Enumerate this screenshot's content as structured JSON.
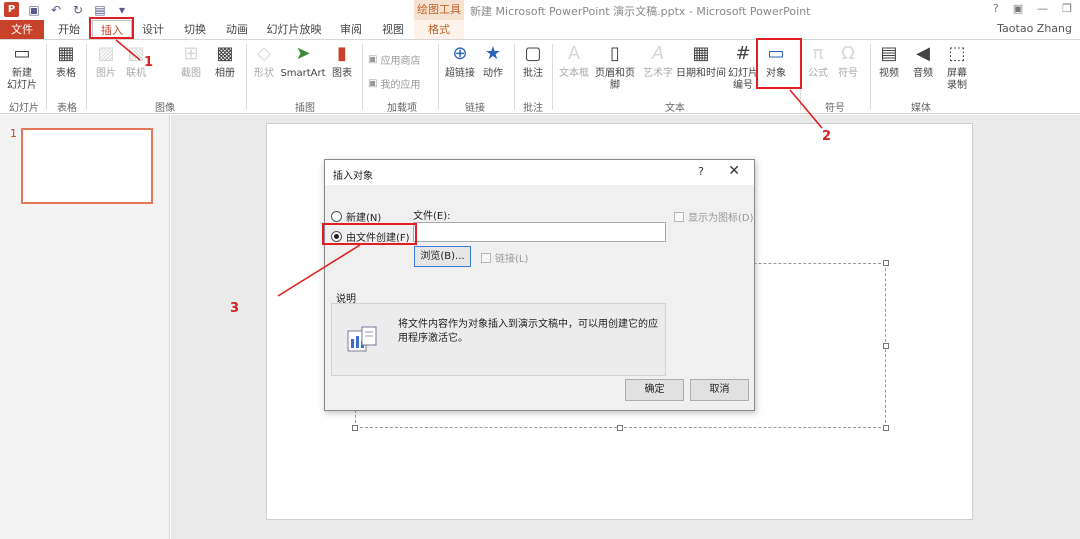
{
  "titlebar": {
    "context_tool": "绘图工具",
    "window_title": "新建 Microsoft PowerPoint 演示文稿.pptx - Microsoft PowerPoint",
    "controls": {
      "help": "?",
      "options": "▣",
      "minimize": "—",
      "restore": "❐"
    }
  },
  "tabs": [
    {
      "label": "文件"
    },
    {
      "label": "开始"
    },
    {
      "label": "插入"
    },
    {
      "label": "设计"
    },
    {
      "label": "切换"
    },
    {
      "label": "动画"
    },
    {
      "label": "幻灯片放映"
    },
    {
      "label": "审阅"
    },
    {
      "label": "视图"
    },
    {
      "label": "格式"
    }
  ],
  "user": "Taotao Zhang",
  "ribbon": {
    "new_slide": "新建\n幻灯片",
    "table": "表格",
    "picture": "图片",
    "online_picture": "联机",
    "screenshot": "截图",
    "album": "相册",
    "shapes": "形状",
    "smartart": "SmartArt",
    "chart": "图表",
    "app_store": "应用商店",
    "my_apps": "我的应用",
    "hyperlink": "超链接",
    "action": "动作",
    "comment": "批注",
    "textbox": "文本框",
    "header_footer": "页眉和页脚",
    "wordart": "艺术字",
    "datetime": "日期和时间",
    "slide_number": "幻灯片\n编号",
    "object": "对象",
    "equation": "公式",
    "symbol": "符号",
    "video": "视频",
    "audio": "音频",
    "screen_record": "屏幕\n录制",
    "groups": {
      "slides": "幻灯片",
      "tables": "表格",
      "images": "图像",
      "illustrations": "插图",
      "addins": "加载项",
      "links": "链接",
      "comments": "批注",
      "text": "文本",
      "symbols": "符号",
      "media": "媒体"
    }
  },
  "thumbnails": {
    "number": "1"
  },
  "dialog": {
    "title": "插入对象",
    "help": "?",
    "close": "✕",
    "create_new": "新建(N)",
    "create_from_file": "由文件创建(F)",
    "file_label": "文件(E):",
    "file_value": "",
    "browse": "浏览(B)...",
    "link": "链接(L)",
    "display_as_icon": "显示为图标(D)",
    "desc_title": "说明",
    "desc_text": "将文件内容作为对象插入到演示文稿中，可以用创建它的应用程序激活它。",
    "ok": "确定",
    "cancel": "取消"
  },
  "annotations": {
    "step1": "1",
    "step2": "2",
    "step3": "3"
  },
  "colors": {
    "accent": "#c8412b",
    "annotation": "#e02020"
  }
}
